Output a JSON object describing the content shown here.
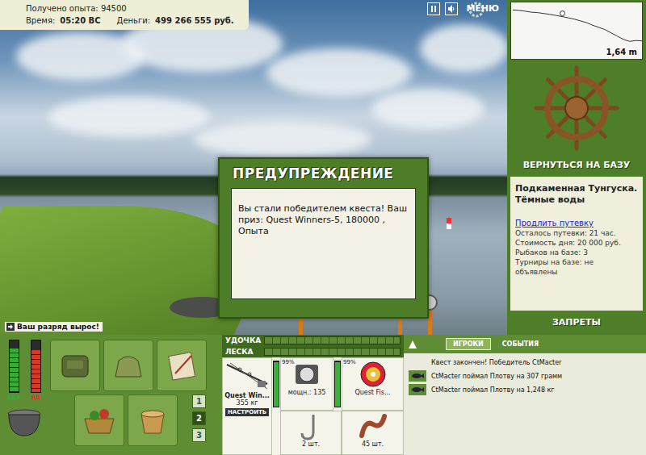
{
  "hud": {
    "experience": "Получено опыта: 94500",
    "time_label": "Время:",
    "time": "05:20 ВС",
    "money_label": "Деньги:",
    "money": "499 266 555 руб."
  },
  "top_controls": {
    "menu": "МЕНЮ"
  },
  "dialog": {
    "title": "ПРЕДУПРЕЖДЕНИЕ",
    "message": "Вы стали победителем квеста! Ваш приз: Quest Winners-5, 180000 , Опыта"
  },
  "notice": "Ваш разряд вырос!",
  "depth_chart": {
    "values": [
      0.2,
      0.22,
      0.25,
      0.3,
      0.32,
      0.36,
      0.4,
      0.45,
      0.5,
      0.56,
      0.62,
      0.7,
      0.78,
      0.9,
      1.0,
      1.1,
      1.25,
      1.4,
      1.55,
      1.64,
      1.6,
      1.62
    ],
    "reading": "1,64 m",
    "marker": {
      "level": 0.38
    }
  },
  "base": {
    "return_button": "ВЕРНУТЬСЯ НА БАЗУ",
    "location": "Подкаменная Тунгуска. Тёмные воды",
    "extend_link": "Продлить путевку",
    "info": [
      "Осталось путевки: 21 час.",
      "Стоимость дня: 20 000 руб.",
      "Рыбаков на базе: 3",
      "Турниры на базе: не объявлены"
    ],
    "bans_button": "ЗАПРЕТЫ"
  },
  "meters": [
    {
      "label": "ЕДА",
      "level": 0.85,
      "color": "#3aa83a"
    },
    {
      "label": "ЯД",
      "level": 0.82,
      "color": "#d23a2a"
    }
  ],
  "slots": [
    {
      "label": "1",
      "selected": false
    },
    {
      "label": "2",
      "selected": true
    },
    {
      "label": "3",
      "selected": false
    }
  ],
  "tackle_bars": [
    {
      "label": "УДОЧКА",
      "level": 0
    },
    {
      "label": "ЛЕСКА",
      "level": 0
    }
  ],
  "gear": {
    "rod": {
      "name": "Quest Win...",
      "weight": "355 кг",
      "condition": "99%",
      "level": 0.99,
      "button": "НАСТРОИТЬ"
    },
    "reel": {
      "power": "мощн.: 135",
      "condition": "99%",
      "level": 0.99
    },
    "line": {
      "name": "Quest Fis..."
    },
    "hook": {
      "count": "2 шт."
    },
    "bait": {
      "count": "45 шт."
    }
  },
  "chat": {
    "tabs": [
      {
        "label": "ИГРОКИ",
        "selected": true
      },
      {
        "label": "СОБЫТИЯ",
        "selected": false
      }
    ],
    "messages": [
      {
        "text": "Квест закончен! Победитель CtMacter",
        "kind": "system"
      },
      {
        "text": "CtMacter поймал Плотву на 307 грамм",
        "kind": "catch"
      },
      {
        "text": "CtMacter поймал Плотву на 1,248 кг",
        "kind": "catch"
      }
    ]
  }
}
